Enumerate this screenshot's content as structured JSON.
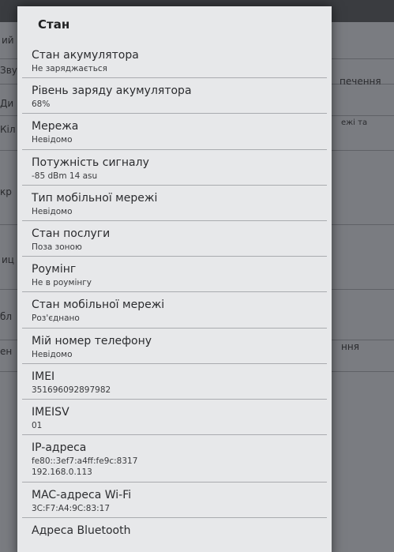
{
  "background": {
    "fragments": [
      {
        "text": "ий",
        "row": 0
      },
      {
        "text": "Зву",
        "row": 1
      },
      {
        "text": "Ди",
        "row": 2
      },
      {
        "text": "Кіл",
        "row": 3
      },
      {
        "text": "кр",
        "row": 4
      },
      {
        "text": "иц",
        "row": 5
      },
      {
        "text": "бл",
        "row": 6
      },
      {
        "text": "ен",
        "row": 7
      }
    ],
    "right_fragments": [
      {
        "text": "печення"
      },
      {
        "text": "ежі та"
      },
      {
        "text": "ння"
      }
    ]
  },
  "dialog": {
    "title": "Стан",
    "items": [
      {
        "label": "Стан акумулятора",
        "value": "Не заряджається"
      },
      {
        "label": "Рівень заряду акумулятора",
        "value": "68%"
      },
      {
        "label": "Мережа",
        "value": "Невідомо"
      },
      {
        "label": "Потужність сигналу",
        "value": "-85 dBm   14 asu"
      },
      {
        "label": "Тип мобільної мережі",
        "value": "Невідомо"
      },
      {
        "label": "Стан послуги",
        "value": "Поза зоною"
      },
      {
        "label": "Роумінг",
        "value": "Не в роумінгу"
      },
      {
        "label": "Стан мобільної мережі",
        "value": "Роз'єднано"
      },
      {
        "label": "Мій номер телефону",
        "value": "Невідомо"
      },
      {
        "label": "IMEI",
        "value": "351696092897982"
      },
      {
        "label": "IMEISV",
        "value": "01"
      }
    ],
    "ip": {
      "label": "IP-адреса",
      "value_ipv6": "fe80::3ef7:a4ff:fe9c:8317",
      "value_ipv4": "192.168.0.113"
    },
    "wifi_mac": {
      "label": "MAC-адреса Wi-Fi",
      "value": "3C:F7:A4:9C:83:17"
    },
    "bluetooth": {
      "label": "Адреса Bluetooth"
    }
  }
}
